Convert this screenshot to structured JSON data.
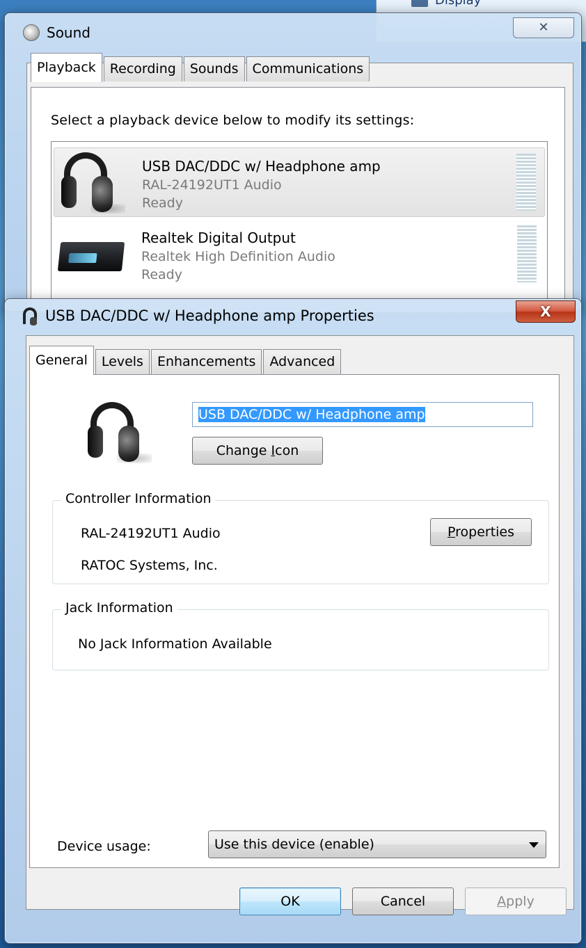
{
  "background_window": {
    "label": "Display"
  },
  "sound_window": {
    "title": "Sound",
    "close_label": "✕",
    "tabs": [
      {
        "label": "Playback",
        "active": true
      },
      {
        "label": "Recording",
        "active": false
      },
      {
        "label": "Sounds",
        "active": false
      },
      {
        "label": "Communications",
        "active": false
      }
    ],
    "instruction": "Select a playback device below to modify its settings:",
    "devices": [
      {
        "name": "USB DAC/DDC w/ Headphone amp",
        "driver": "RAL-24192UT1 Audio",
        "status": "Ready",
        "icon": "headphones-icon",
        "selected": true
      },
      {
        "name": "Realtek Digital Output",
        "driver": "Realtek High Definition Audio",
        "status": "Ready",
        "icon": "receiver-icon",
        "selected": false
      }
    ]
  },
  "properties_window": {
    "title": "USB DAC/DDC w/ Headphone amp Properties",
    "close_label": "X",
    "tabs": [
      {
        "label": "General",
        "active": true
      },
      {
        "label": "Levels",
        "active": false
      },
      {
        "label": "Enhancements",
        "active": false
      },
      {
        "label": "Advanced",
        "active": false
      }
    ],
    "device_name_value": "USB DAC/DDC w/ Headphone amp",
    "change_icon_button": {
      "pre": "Change ",
      "accel": "I",
      "post": "con"
    },
    "controller": {
      "group_label": "Controller Information",
      "name": "RAL-24192UT1 Audio",
      "manufacturer": "RATOC Systems, Inc.",
      "properties_button": {
        "pre": "",
        "accel": "P",
        "post": "roperties"
      }
    },
    "jack": {
      "group_label": "Jack Information",
      "text": "No Jack Information Available"
    },
    "device_usage": {
      "label": "Device usage:",
      "selected": "Use this device (enable)"
    },
    "buttons": {
      "ok": "OK",
      "cancel": "Cancel",
      "apply": {
        "pre": "",
        "accel": "A",
        "post": "pply"
      }
    }
  },
  "colors": {
    "selection": "#3399ff",
    "close_active": "#c7472b",
    "default_button_border": "#3c7fb1"
  }
}
